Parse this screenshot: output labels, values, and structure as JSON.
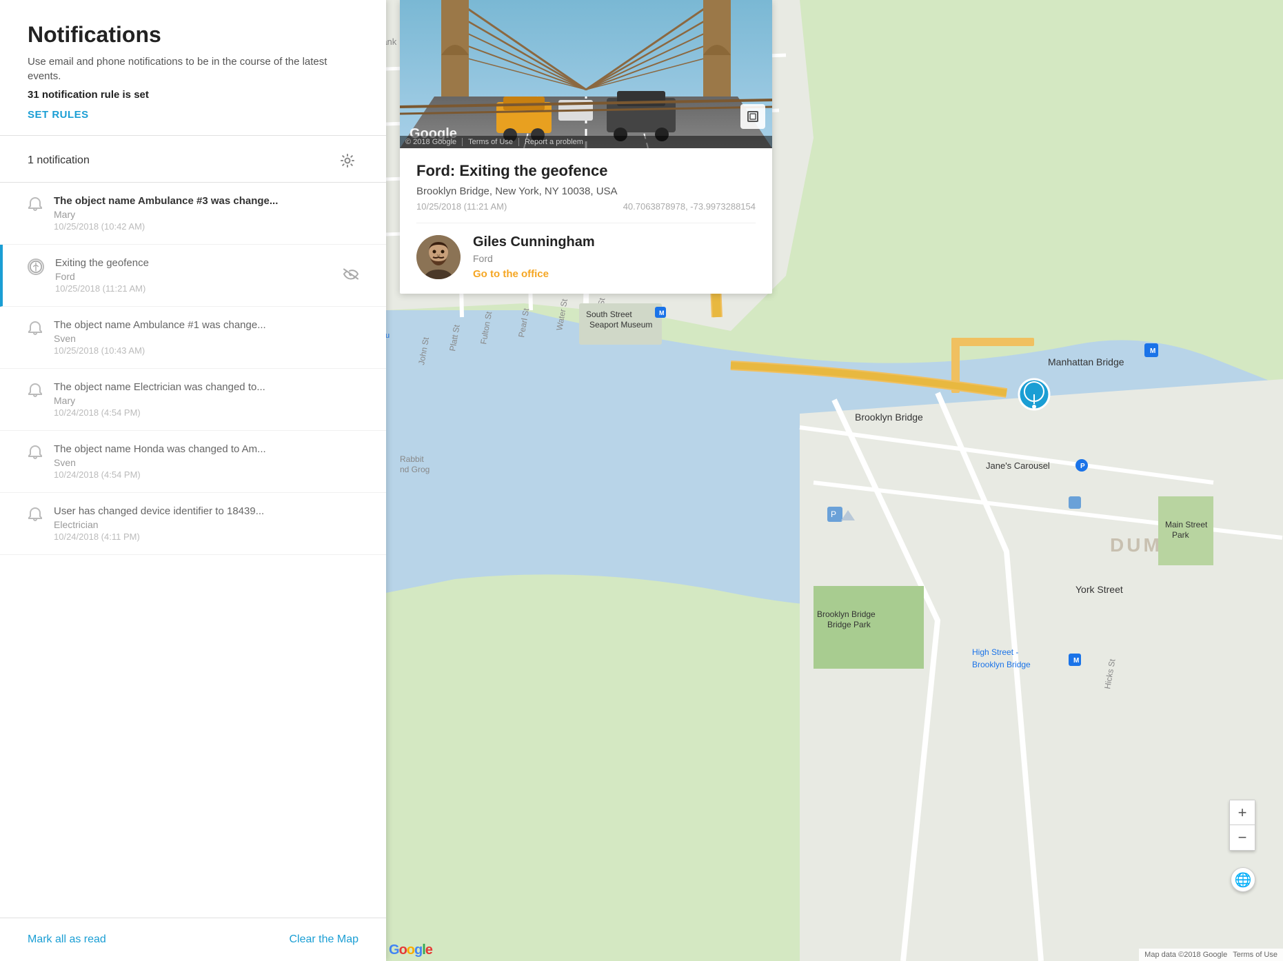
{
  "notifications": {
    "title": "Notifications",
    "description": "Use email and phone notifications to be in the course of the latest events.",
    "rule_count": "31 notification rule is set",
    "set_rules_label": "SET RULES",
    "list_header": "1 notification",
    "items": [
      {
        "id": 1,
        "type": "bell",
        "title": "The object name Ambulance #3 was change...",
        "subtitle": "Mary",
        "time": "10/25/2018 (10:42 AM)",
        "read": false,
        "active": false,
        "has_eye": false
      },
      {
        "id": 2,
        "type": "geofence",
        "title": "Exiting the geofence",
        "subtitle": "Ford",
        "time": "10/25/2018 (11:21 AM)",
        "read": false,
        "active": true,
        "has_eye": true
      },
      {
        "id": 3,
        "type": "bell",
        "title": "The object name Ambulance #1 was change...",
        "subtitle": "Sven",
        "time": "10/25/2018 (10:43 AM)",
        "read": true,
        "active": false,
        "has_eye": false
      },
      {
        "id": 4,
        "type": "bell",
        "title": "The object name Electrician was changed to...",
        "subtitle": "Mary",
        "time": "10/24/2018 (4:54 PM)",
        "read": true,
        "active": false,
        "has_eye": false
      },
      {
        "id": 5,
        "type": "bell",
        "title": "The object name Honda was changed to Am...",
        "subtitle": "Sven",
        "time": "10/24/2018 (4:54 PM)",
        "read": true,
        "active": false,
        "has_eye": false
      },
      {
        "id": 6,
        "type": "bell",
        "title": "User has changed device identifier to 18439...",
        "subtitle": "Electrician",
        "time": "10/24/2018 (4:11 PM)",
        "read": true,
        "active": false,
        "has_eye": false
      }
    ],
    "footer": {
      "mark_all_read": "Mark all as read",
      "clear_map": "Clear the Map"
    }
  },
  "info_card": {
    "event_title": "Ford: Exiting the geofence",
    "address": "Brooklyn Bridge, New York, NY 10038, USA",
    "timestamp": "10/25/2018 (11:21 AM)",
    "coordinates": "40.7063878978, -73.9973288154",
    "person": {
      "name": "Giles Cunningham",
      "vehicle": "Ford",
      "task": "Go to the office"
    },
    "street_view": {
      "google_label": "Google",
      "copyright": "© 2018 Google",
      "terms": "Terms of Use",
      "report": "Report a problem"
    }
  },
  "map": {
    "zoom_in": "+",
    "zoom_out": "−",
    "attribution": "Map data ©2018 Google",
    "terms": "Terms of Use",
    "google_logo": "Google"
  }
}
